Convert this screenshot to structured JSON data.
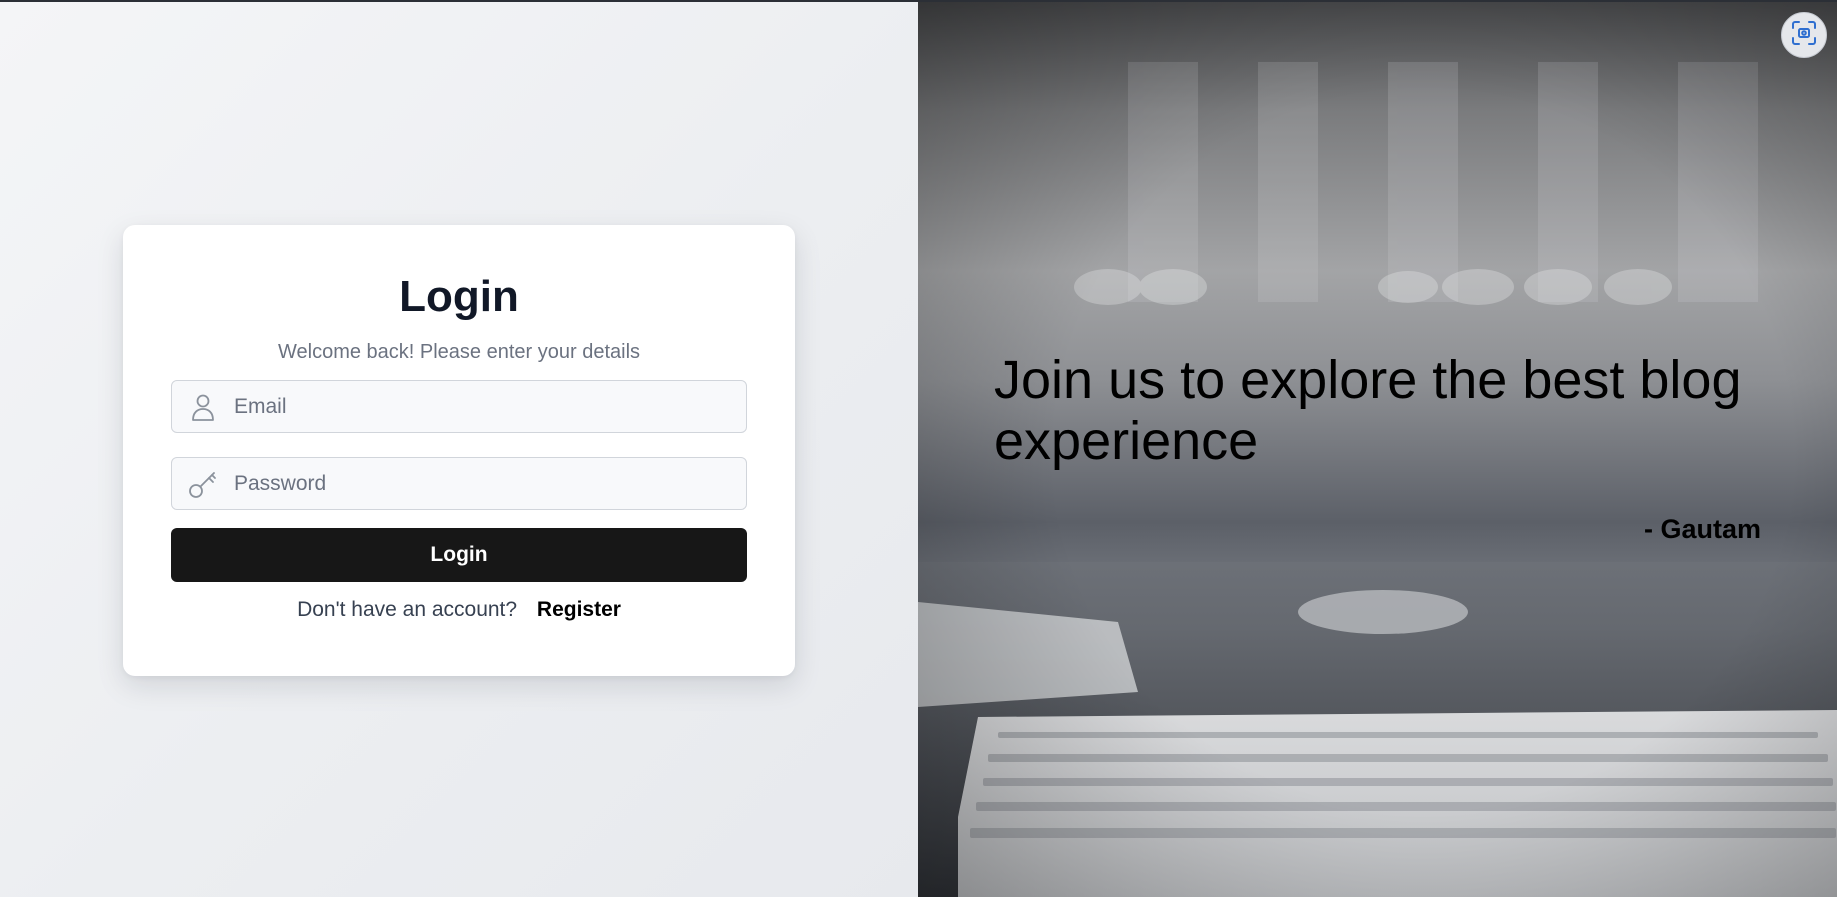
{
  "login_card": {
    "title": "Login",
    "subtitle": "Welcome back! Please enter your details",
    "email": {
      "placeholder": "Email",
      "value": "",
      "icon": "user-icon"
    },
    "password": {
      "placeholder": "Password",
      "value": "",
      "icon": "key-icon"
    },
    "submit_label": "Login",
    "register_prompt": "Don't have an account?",
    "register_link": "Register"
  },
  "hero": {
    "quote": "Join us to explore the best blog experience",
    "author": "- Gautam",
    "background": "keyboard-desk-photo"
  },
  "overlay": {
    "screenshot_button_icon": "screen-capture-icon"
  },
  "colors": {
    "primary_button": "#171717",
    "text_dark": "#111827",
    "text_muted": "#6b7280",
    "page_background": "#eef0f3",
    "card_background": "#ffffff"
  }
}
